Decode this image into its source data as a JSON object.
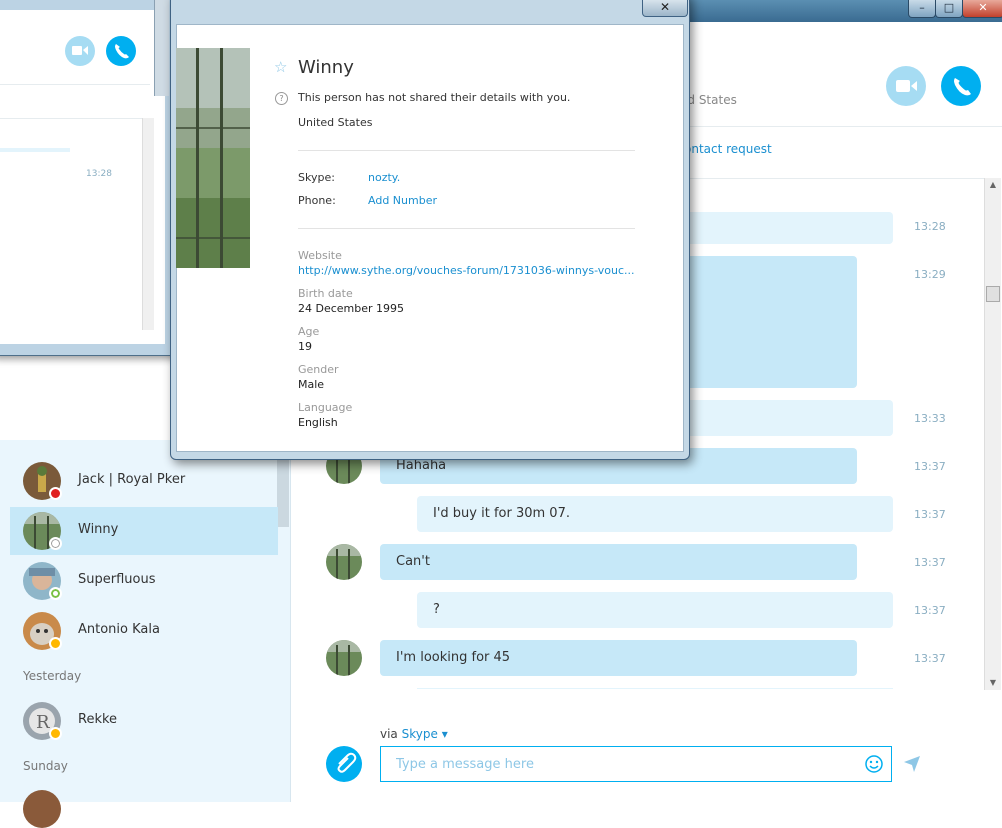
{
  "window_controls": {
    "minimize": "–",
    "maximize": "□",
    "close": "✕"
  },
  "main": {
    "header_location": "ed States",
    "contact_request_link": "ontact request"
  },
  "sidebar": {
    "contacts": [
      {
        "name": "Jack | Royal Pker",
        "status": "busy"
      },
      {
        "name": "Winny",
        "status": "unknown",
        "selected": true
      },
      {
        "name": "Superfluous",
        "status": "online"
      },
      {
        "name": "Antonio Kala",
        "status": "away"
      }
    ],
    "section_yesterday": "Yesterday",
    "contacts_yesterday": [
      {
        "name": "Rekke",
        "status": "away"
      }
    ],
    "section_sunday": "Sunday"
  },
  "messages": [
    {
      "dir": "out",
      "text": "",
      "time": "13:28"
    },
    {
      "dir": "in",
      "text": "",
      "time": "13:29"
    },
    {
      "dir": "out",
      "text": "",
      "time": "13:33"
    },
    {
      "dir": "in",
      "text": "Hahaha",
      "time": "13:37"
    },
    {
      "dir": "out",
      "text": "I'd buy it for 30m 07.",
      "time": "13:37"
    },
    {
      "dir": "in",
      "text": "Can't",
      "time": "13:37"
    },
    {
      "dir": "out",
      "text": "?",
      "time": "13:37"
    },
    {
      "dir": "in",
      "text": "I'm looking for 45",
      "time": "13:37"
    }
  ],
  "compose": {
    "via_prefix": "via",
    "via_service": "Skype",
    "placeholder": "Type a message here"
  },
  "left_window": {
    "time": "13:28"
  },
  "profile": {
    "name": "Winny",
    "privacy_note": "This person has not shared their details with you.",
    "country": "United States",
    "skype_label": "Skype:",
    "skype_value": "nozty.",
    "phone_label": "Phone:",
    "phone_value": "Add Number",
    "website_label": "Website",
    "website_value": "http://www.sythe.org/vouches-forum/1731036-winnys-vouc...",
    "birth_label": "Birth date",
    "birth_value": "24 December 1995",
    "age_label": "Age",
    "age_value": "19",
    "gender_label": "Gender",
    "gender_value": "Male",
    "language_label": "Language",
    "language_value": "English"
  },
  "colors": {
    "accent": "#00aff0",
    "bubble_in": "#c6e8f8",
    "bubble_out": "#e3f4fc",
    "link": "#1a8fd0"
  }
}
